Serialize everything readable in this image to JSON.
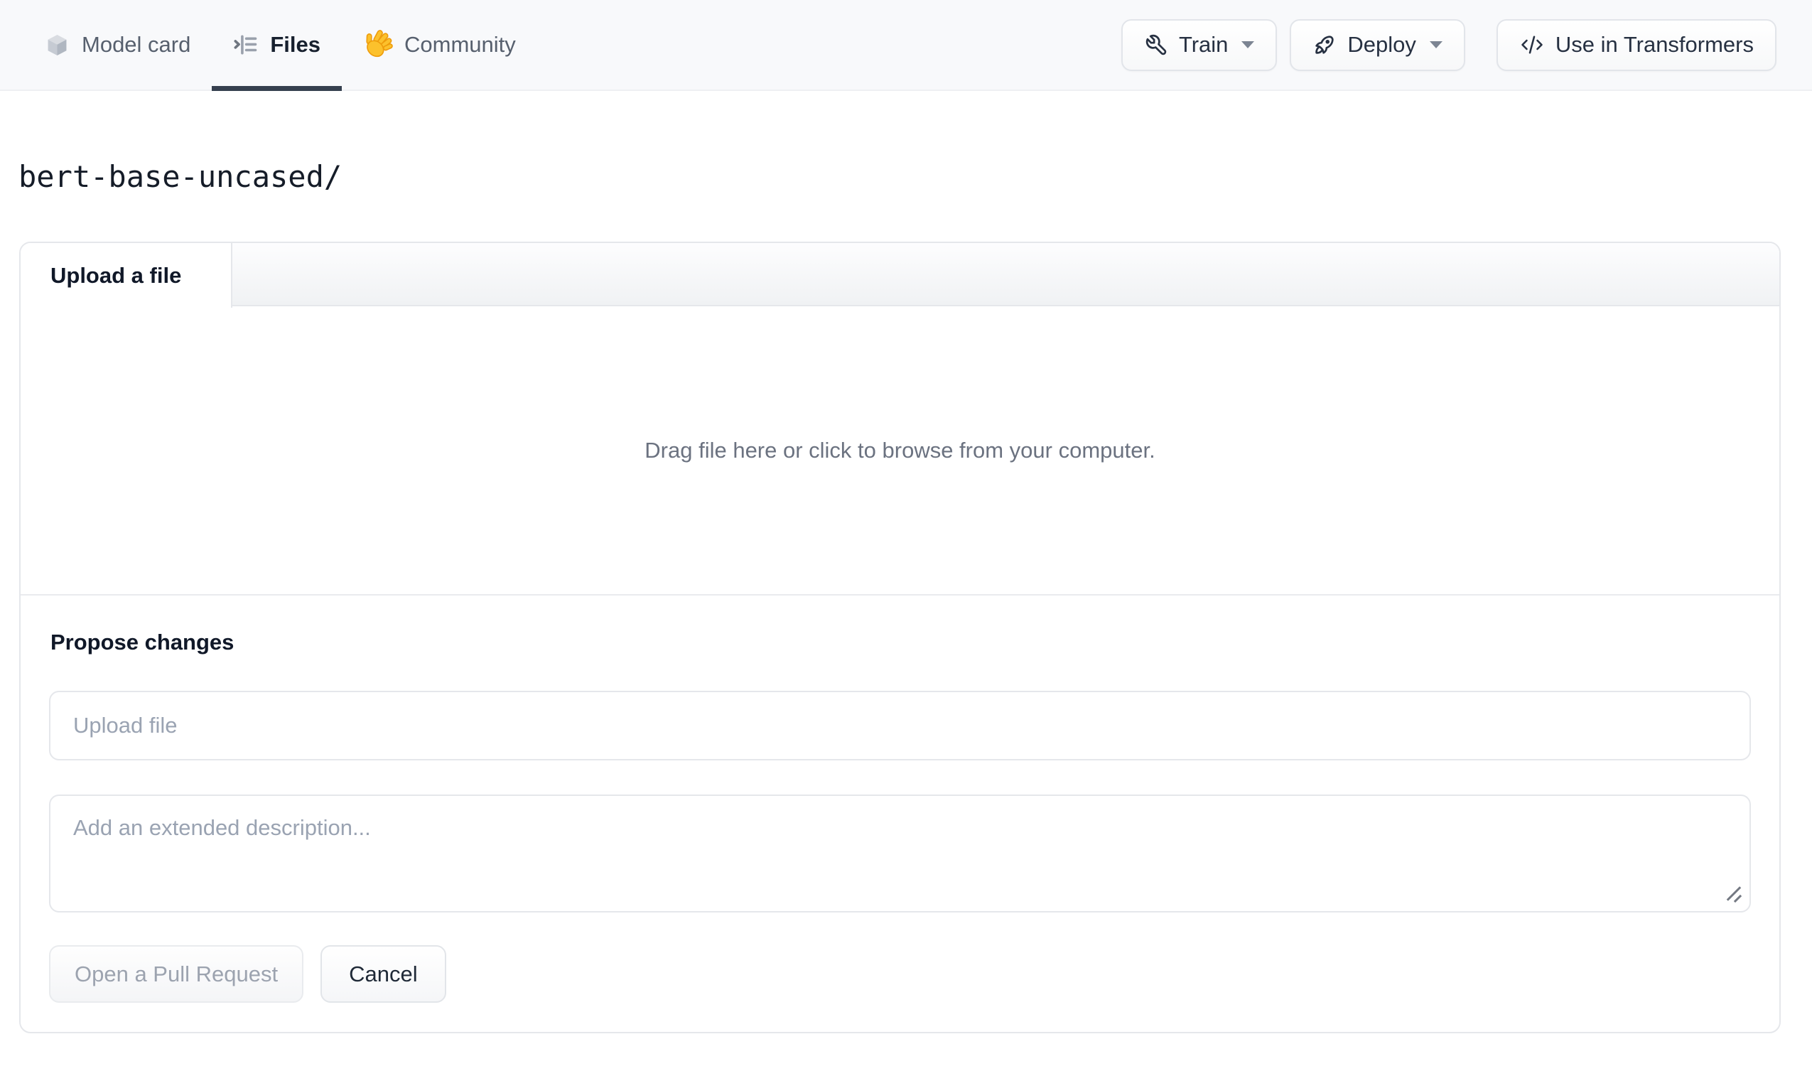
{
  "header": {
    "background": "#f8f9fb",
    "active_underline_color": "#36404f",
    "tabs": [
      {
        "label": "Model card",
        "icon": "cube-icon",
        "active": false
      },
      {
        "label": "Files",
        "icon": "files-list-icon",
        "active": true
      },
      {
        "label": "Community",
        "icon": "waving-hand-icon",
        "active": false
      }
    ],
    "actions": [
      {
        "label": "Train",
        "icon": "wrench-icon",
        "caret": true
      },
      {
        "label": "Deploy",
        "icon": "rocket-icon",
        "caret": true
      },
      {
        "label": "Use in Transformers",
        "icon": "code-icon",
        "caret": false
      }
    ]
  },
  "breadcrumb": {
    "path": "bert-base-uncased/"
  },
  "upload_panel": {
    "tab_label": "Upload a file",
    "dropzone_text": "Drag file here or click to browse from your computer.",
    "propose": {
      "heading": "Propose changes",
      "filename_placeholder": "Upload file",
      "description_placeholder": "Add an extended description...",
      "submit_label": "Open a Pull Request",
      "cancel_label": "Cancel"
    }
  },
  "colors": {
    "text_dark": "#1f2937",
    "text_muted": "#6b7280",
    "placeholder": "#9aa3b2",
    "border": "#e5e7eb",
    "disabled_text": "#9ca3af",
    "hand_fill": "#fcc12c",
    "hand_stroke": "#ee9c0c"
  }
}
